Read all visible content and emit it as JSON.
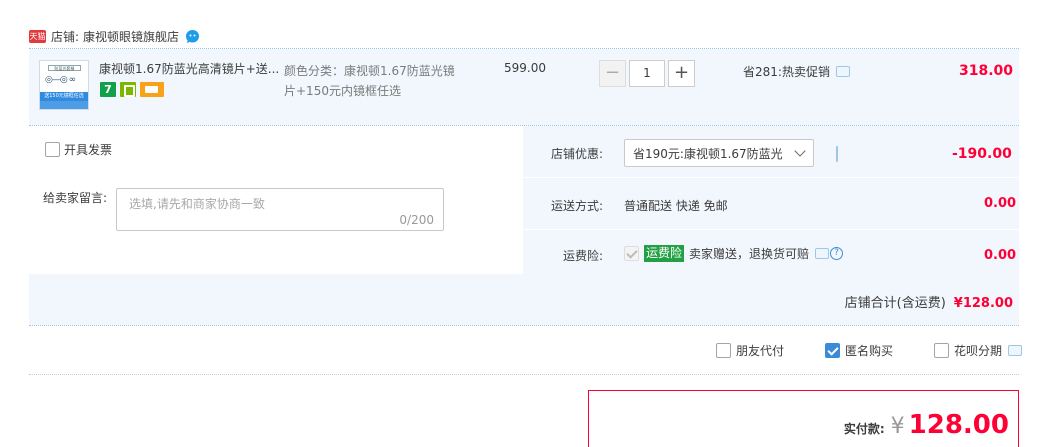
{
  "shop": {
    "badge": "天猫",
    "label": "店铺:",
    "name": "康视顿眼镜旗舰店"
  },
  "item": {
    "thumb_top_text": "防蓝光套餐",
    "thumb_band_text": "送150元镜框任选",
    "title": "康视顿1.67防蓝光高清镜片+送...",
    "icon_seven": "7",
    "spec_line1": "颜色分类：康视顿1.67防蓝光镜",
    "spec_line2": "片+150元内镜框任选",
    "price": "599.00",
    "quantity": "1",
    "promo": "省281:热卖促销",
    "total": "318.00"
  },
  "order": {
    "invoice_label": "开具发票",
    "message_label": "给卖家留言:",
    "message_placeholder": "选填,请先和商家协商一致",
    "message_count": "0/200",
    "shop_discount_label": "店铺优惠:",
    "shop_discount_option": "省190元:康视顿1.67防蓝光",
    "shop_discount_amount": "-190.00",
    "shipping_label": "运送方式:",
    "shipping_method": "普通配送 快递 免邮",
    "shipping_fee": "0.00",
    "insurance_label": "运费险:",
    "insurance_tag": "运费险",
    "insurance_text": "卖家赠送，退换货可赔",
    "insurance_fee": "0.00",
    "shop_total_label": "店铺合计(含运费)",
    "shop_total_amount": "¥128.00"
  },
  "options": {
    "friend_pay": "朋友代付",
    "anonymous": "匿名购买",
    "huabei": "花呗分期"
  },
  "payment": {
    "label": "实付款:",
    "currency": "¥",
    "amount": "128.00"
  },
  "colors": {
    "accent_red": "#ff0036",
    "panel_blue": "#f2f7fd",
    "insurance_green": "#23a045",
    "check_blue": "#3c8bd9"
  }
}
